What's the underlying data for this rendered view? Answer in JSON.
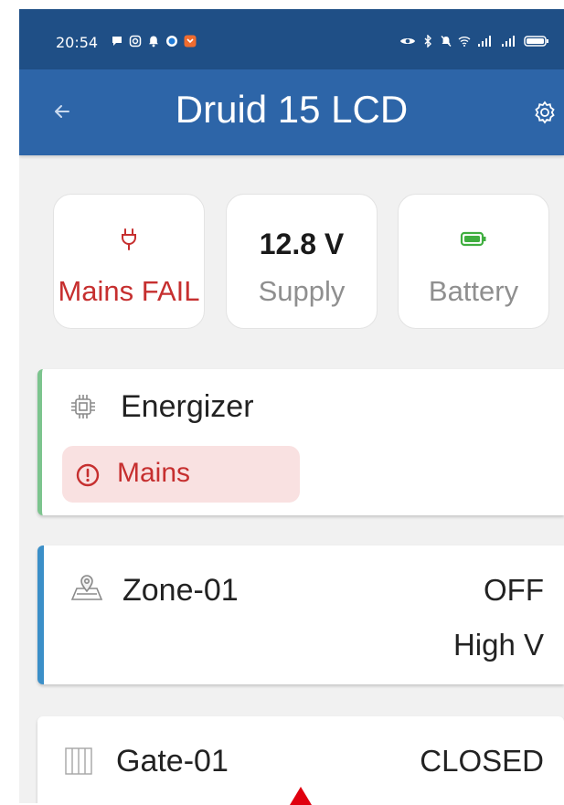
{
  "status_bar": {
    "time": "20:54",
    "left_icons": [
      "chat-icon",
      "instagram-icon",
      "notification-bell-icon",
      "vpn-icon",
      "app-shield-icon"
    ],
    "right_icons": [
      "eye-icon",
      "bluetooth-icon",
      "silent-icon",
      "wifi-icon",
      "signal-icon",
      "signal-icon",
      "battery-icon"
    ]
  },
  "app_bar": {
    "title": "Druid 15 LCD",
    "back_icon": "arrow-left-icon",
    "settings_icon": "gear-icon"
  },
  "tiles": [
    {
      "icon": "power-plug-icon",
      "label": "Mains FAIL",
      "alert": true,
      "color": "#c62f2f"
    },
    {
      "value": "12.8 V",
      "label": "Supply"
    },
    {
      "icon": "battery-icon",
      "label": "Battery",
      "color": "#3fae3f"
    }
  ],
  "energizer": {
    "title": "Energizer",
    "icon": "chip-icon",
    "accent": "#7cc48e",
    "alert_chip": {
      "icon": "alert-circle-icon",
      "label": "Mains"
    }
  },
  "zone": {
    "title": "Zone-01",
    "icon": "map-pin-icon",
    "accent": "#3b8fc8",
    "state": "OFF",
    "voltage_mode": "High V"
  },
  "gate": {
    "title": "Gate-01",
    "icon": "gate-icon",
    "state": "CLOSED"
  }
}
